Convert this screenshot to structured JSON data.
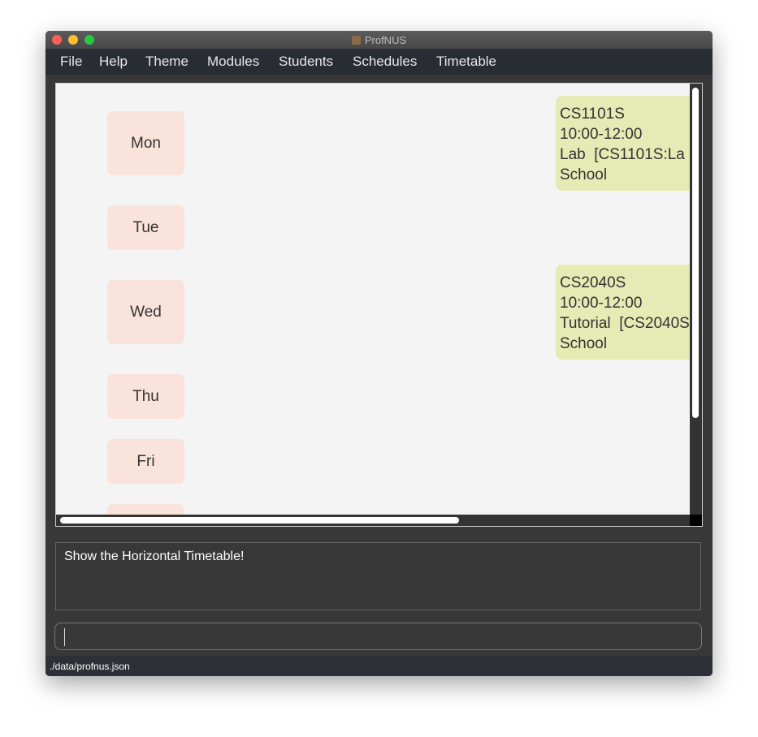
{
  "window": {
    "title": "ProfNUS",
    "colors": {
      "close": "#fe5f57",
      "minimize": "#febc2e",
      "maximize": "#28c840"
    }
  },
  "menu": [
    "File",
    "Help",
    "Theme",
    "Modules",
    "Students",
    "Schedules",
    "Timetable"
  ],
  "timetable": {
    "days": [
      "Mon",
      "Tue",
      "Wed",
      "Thu",
      "Fri"
    ],
    "lessons": [
      {
        "module": "CS1101S",
        "time": "10:00-12:00",
        "type": "Lab  [CS1101S:La",
        "venue": "School"
      },
      {
        "module": "CS2040S",
        "time": "10:00-12:00",
        "type": "Tutorial  [CS2040S",
        "venue": "School"
      }
    ],
    "colors": {
      "day": "#fae3da",
      "lesson": "#e5ebb4"
    }
  },
  "result": "Show the Horizontal Timetable!",
  "command": {
    "value": ""
  },
  "status": "./data/profnus.json"
}
